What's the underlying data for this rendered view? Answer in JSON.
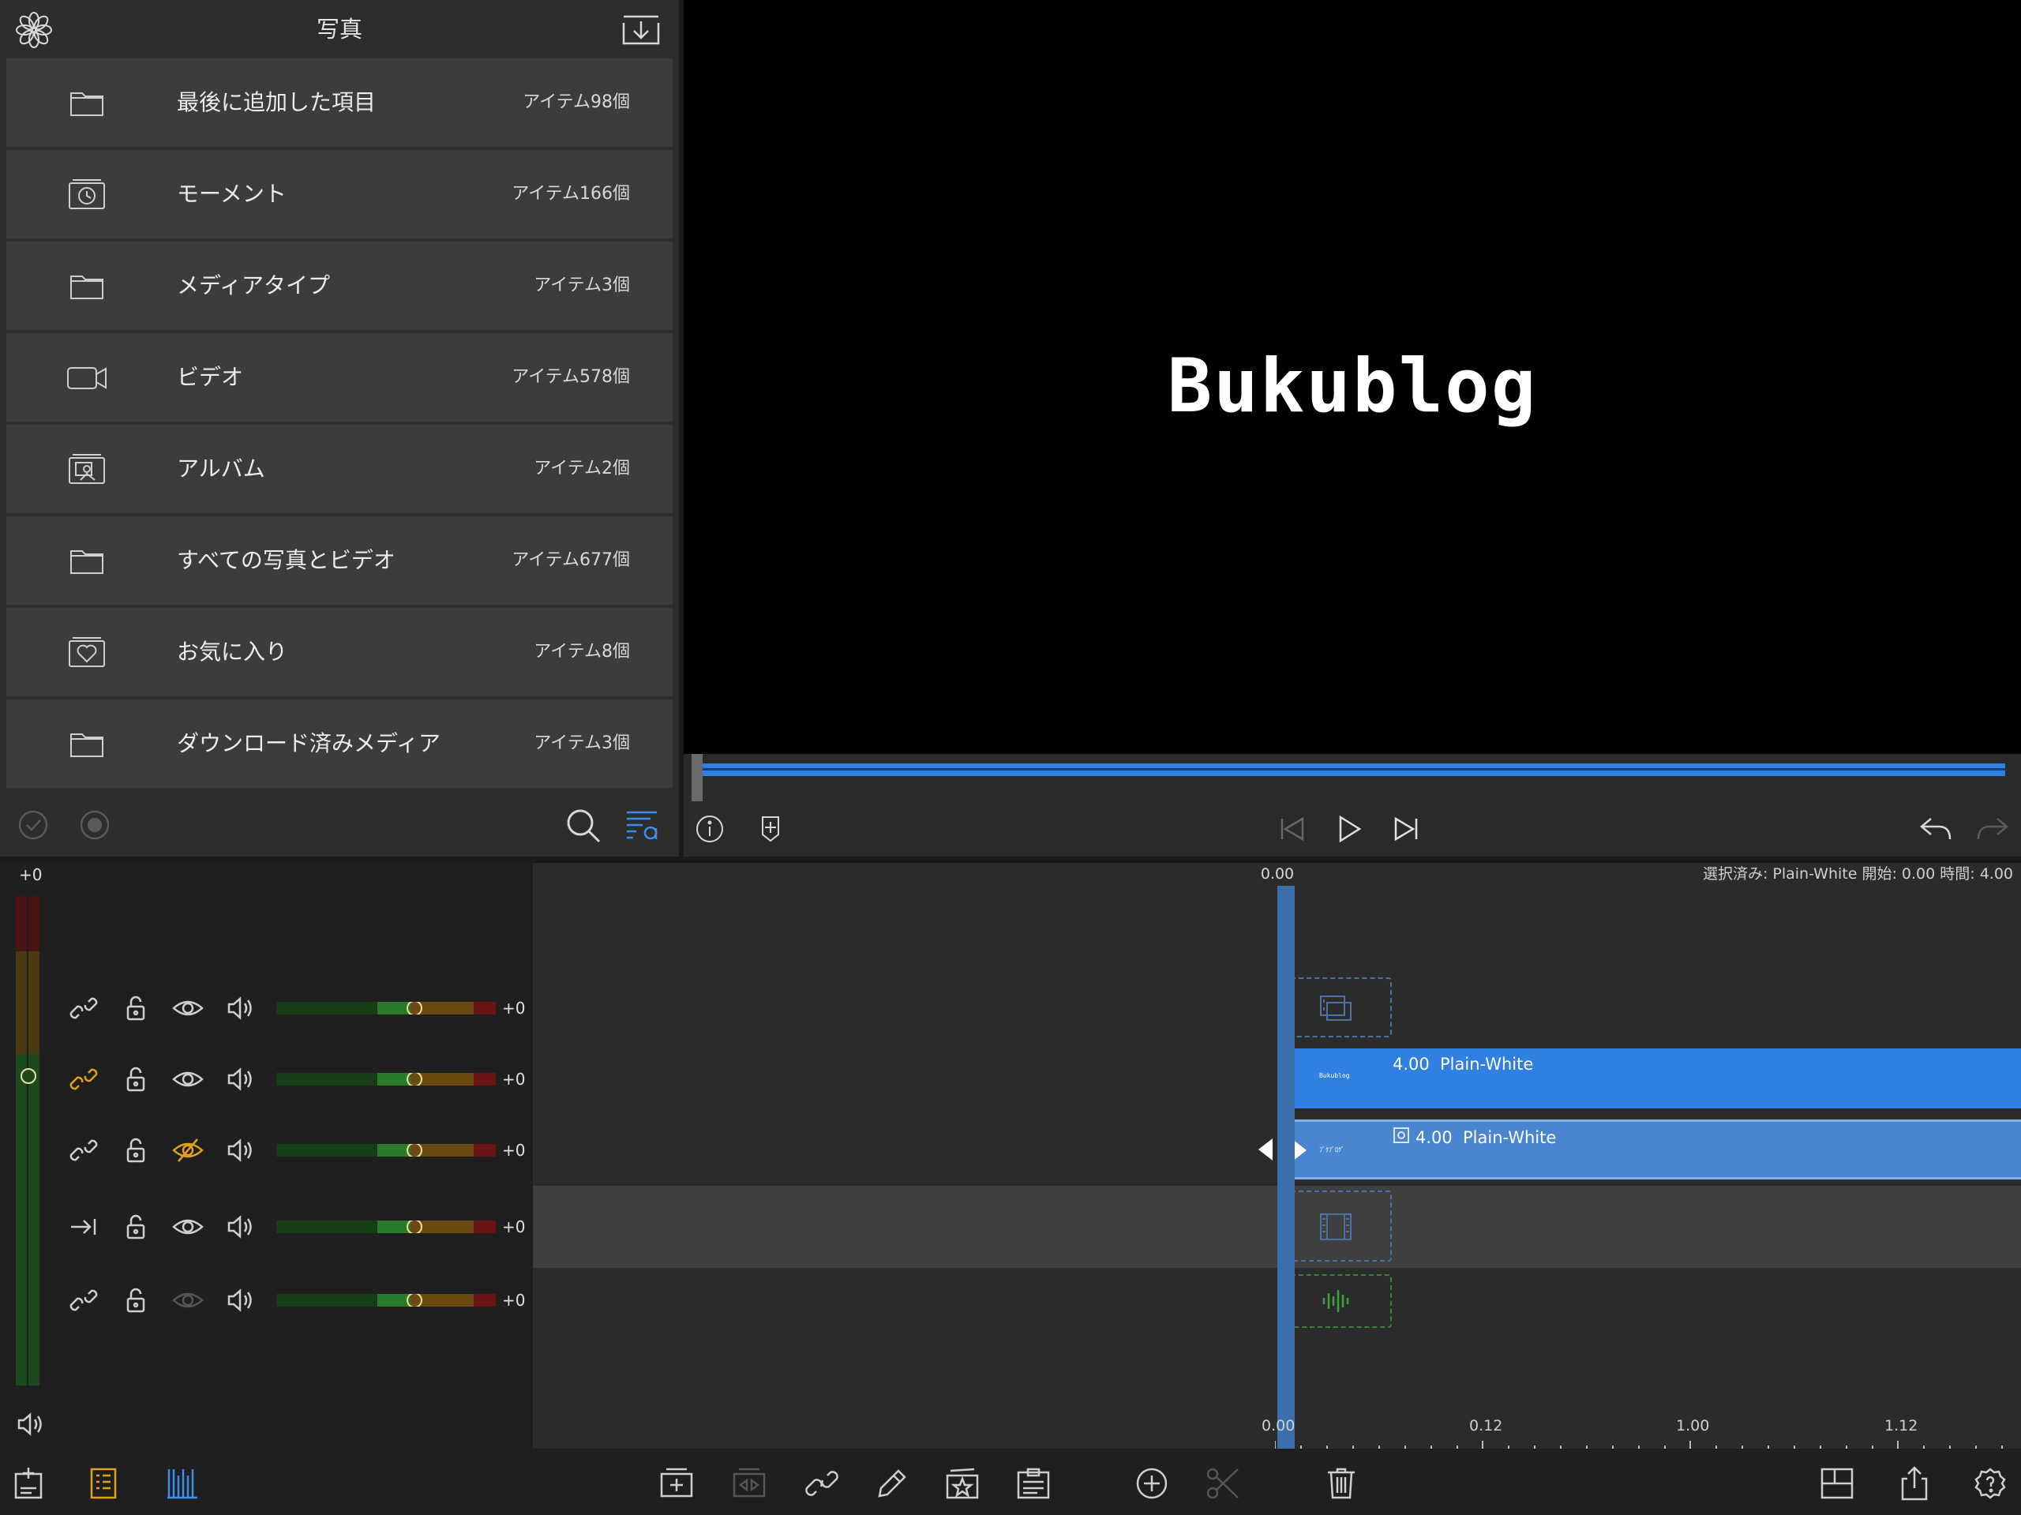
{
  "browser": {
    "title": "写真",
    "items": [
      {
        "label": "最後に追加した項目",
        "count": "アイテム98個",
        "icon": "folder-icon"
      },
      {
        "label": "モーメント",
        "count": "アイテム166個",
        "icon": "moments-icon"
      },
      {
        "label": "メディアタイプ",
        "count": "アイテム3個",
        "icon": "folder-icon"
      },
      {
        "label": "ビデオ",
        "count": "アイテム578個",
        "icon": "video-camera-icon"
      },
      {
        "label": "アルバム",
        "count": "アイテム2個",
        "icon": "album-icon"
      },
      {
        "label": "すべての写真とビデオ",
        "count": "アイテム677個",
        "icon": "folder-icon"
      },
      {
        "label": "お気に入り",
        "count": "アイテム8個",
        "icon": "favorites-icon"
      },
      {
        "label": "ダウンロード済みメディア",
        "count": "アイテム3個",
        "icon": "folder-icon"
      }
    ]
  },
  "viewer": {
    "title_text": "Bukublog"
  },
  "timeline": {
    "top_timecode": "0.00",
    "selection_info": "選択済み: Plain-White 開始: 0.00 時間: 4.00",
    "master_level": "+0",
    "tracks": [
      {
        "level": "+0"
      },
      {
        "level": "+0"
      },
      {
        "level": "+0"
      },
      {
        "level": "+0"
      },
      {
        "level": "+0"
      }
    ],
    "clips": [
      {
        "duration": "4.00",
        "name": "Plain-White",
        "thumb": "Bukublog"
      },
      {
        "duration": "4.00",
        "name": "Plain-White",
        "thumb": "ﾌﾞｸﾌﾞﾛｸﾞ"
      }
    ],
    "ruler": [
      "0.00",
      "0.12",
      "1.00",
      "1.12"
    ]
  },
  "colors": {
    "accent_blue": "#2f80e0",
    "accent_orange": "#e0a020",
    "background": "#1c1c1c"
  }
}
